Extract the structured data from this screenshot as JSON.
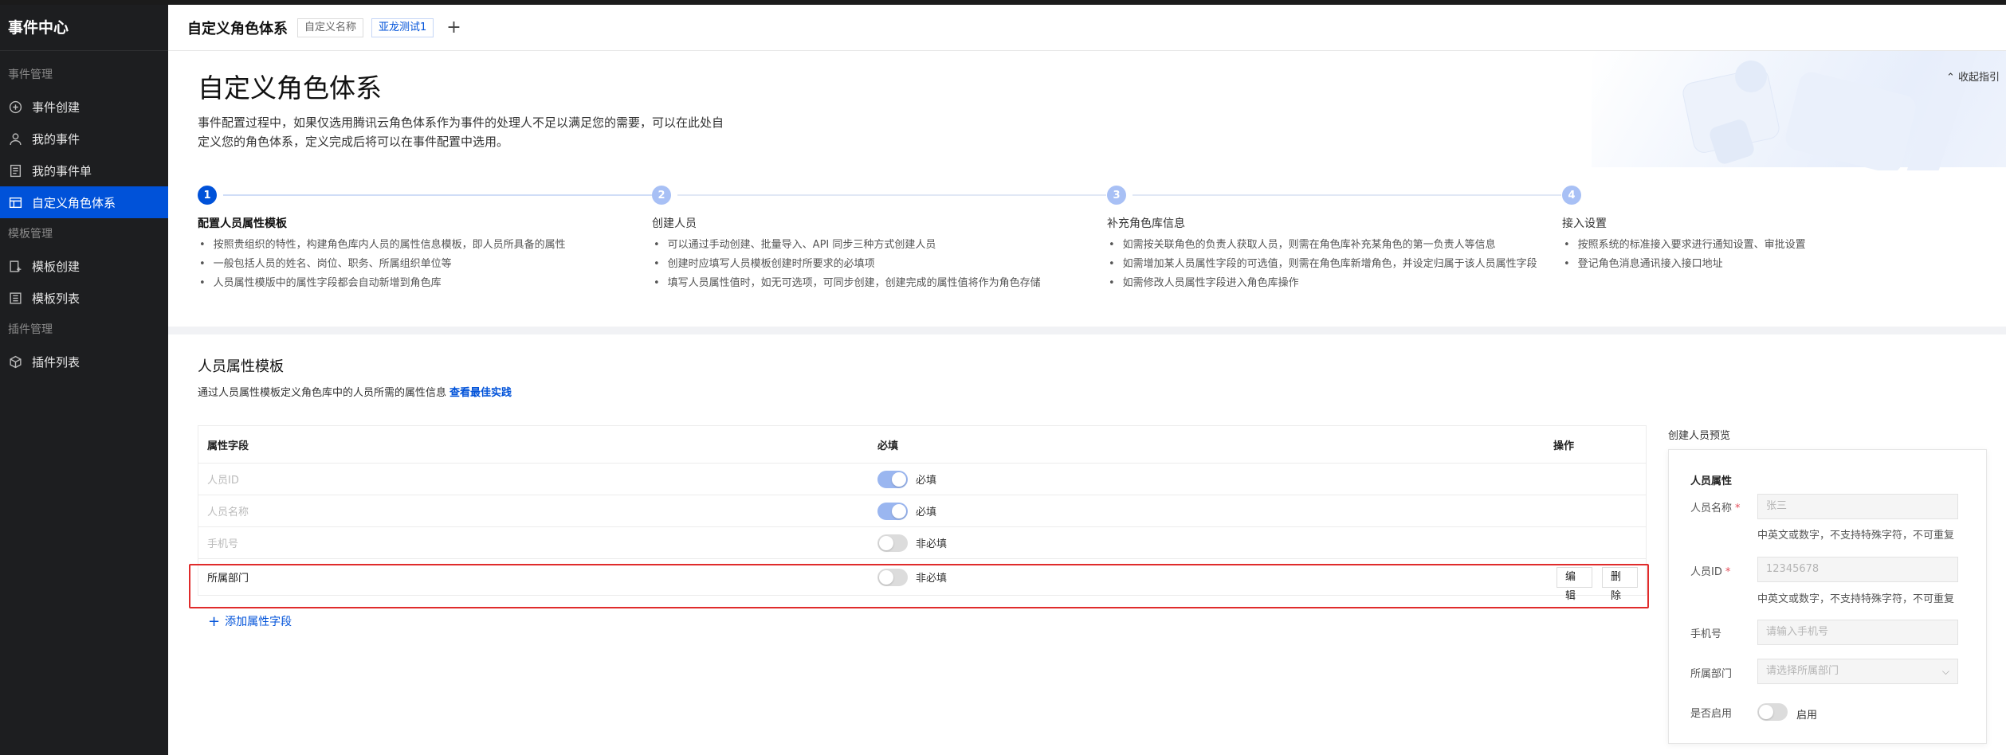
{
  "sidebar": {
    "title": "事件中心",
    "sections": [
      {
        "label": "事件管理",
        "items": [
          {
            "label": "事件创建",
            "icon": "plus-circle-icon"
          },
          {
            "label": "我的事件",
            "icon": "user-icon"
          },
          {
            "label": "我的事件单",
            "icon": "document-icon"
          },
          {
            "label": "自定义角色体系",
            "icon": "role-system-icon",
            "active": true
          }
        ]
      },
      {
        "label": "模板管理",
        "items": [
          {
            "label": "模板创建",
            "icon": "template-add-icon"
          },
          {
            "label": "模板列表",
            "icon": "template-list-icon"
          }
        ]
      },
      {
        "label": "插件管理",
        "items": [
          {
            "label": "插件列表",
            "icon": "plugin-icon"
          }
        ]
      }
    ]
  },
  "header": {
    "title": "自定义角色体系",
    "tabs": [
      "自定义名称",
      "亚龙测试1"
    ],
    "add_tab": "+"
  },
  "intro": {
    "title": "自定义角色体系",
    "description": "事件配置过程中，如果仅选用腾讯云角色体系作为事件的处理人不足以满足您的需要，可以在此处自定义您的角色体系，定义完成后将可以在事件配置中选用。",
    "collapse_label": "收起指引"
  },
  "steps": [
    {
      "num": "1",
      "title": "配置人员属性模板",
      "active": true,
      "bullets": [
        "按照贵组织的特性，构建角色库内人员的属性信息模板，即人员所具备的属性",
        "一般包括人员的姓名、岗位、职务、所属组织单位等",
        "人员属性模版中的属性字段都会自动新增到角色库"
      ]
    },
    {
      "num": "2",
      "title": "创建人员",
      "active": false,
      "bullets": [
        "可以通过手动创建、批量导入、API 同步三种方式创建人员",
        "创建时应填写人员模板创建时所要求的必填项",
        "填写人员属性值时，如无可选项，可同步创建，创建完成的属性值将作为角色存储"
      ]
    },
    {
      "num": "3",
      "title": "补充角色库信息",
      "active": false,
      "bullets": [
        "如需按关联角色的负责人获取人员，则需在角色库补充某角色的第一负责人等信息",
        "如需增加某人员属性字段的可选值，则需在角色库新增角色，并设定归属于该人员属性字段",
        "如需修改人员属性字段进入角色库操作"
      ]
    },
    {
      "num": "4",
      "title": "接入设置",
      "active": false,
      "bullets": [
        "按照系统的标准接入要求进行通知设置、审批设置",
        "登记角色消息通讯接入接口地址"
      ]
    }
  ],
  "template": {
    "title": "人员属性模板",
    "description": "通过人员属性模板定义角色库中的人员所需的属性信息",
    "best_practice_link": "查看最佳实践",
    "columns": [
      "属性字段",
      "必填",
      "操作"
    ],
    "rows": [
      {
        "field": "人员ID",
        "required": true,
        "required_label": "必填",
        "disabled": true
      },
      {
        "field": "人员名称",
        "required": true,
        "required_label": "必填",
        "disabled": true
      },
      {
        "field": "手机号",
        "required": false,
        "required_label": "非必填",
        "disabled": true
      },
      {
        "field": "所属部门",
        "required": false,
        "required_label": "非必填",
        "disabled": false,
        "actions": [
          "编辑",
          "删除"
        ]
      }
    ],
    "add_field_label": "添加属性字段"
  },
  "preview": {
    "label": "创建人员预览",
    "section_title": "人员属性",
    "fields": [
      {
        "label": "人员名称",
        "required": true,
        "placeholder": "张三",
        "hint": "中英文或数字，不支持特殊字符，不可重复"
      },
      {
        "label": "人员ID",
        "required": true,
        "placeholder": "12345678",
        "hint": "中英文或数字，不支持特殊字符，不可重复"
      },
      {
        "label": "手机号",
        "required": false,
        "placeholder": "请输入手机号"
      },
      {
        "label": "所属部门",
        "required": false,
        "placeholder": "请选择所属部门"
      },
      {
        "label": "是否启用",
        "toggle_label": "启用"
      }
    ]
  },
  "colors": {
    "accent": "#0052d9",
    "sidebar_bg": "#1d1e20",
    "highlight": "#e02b2b"
  }
}
